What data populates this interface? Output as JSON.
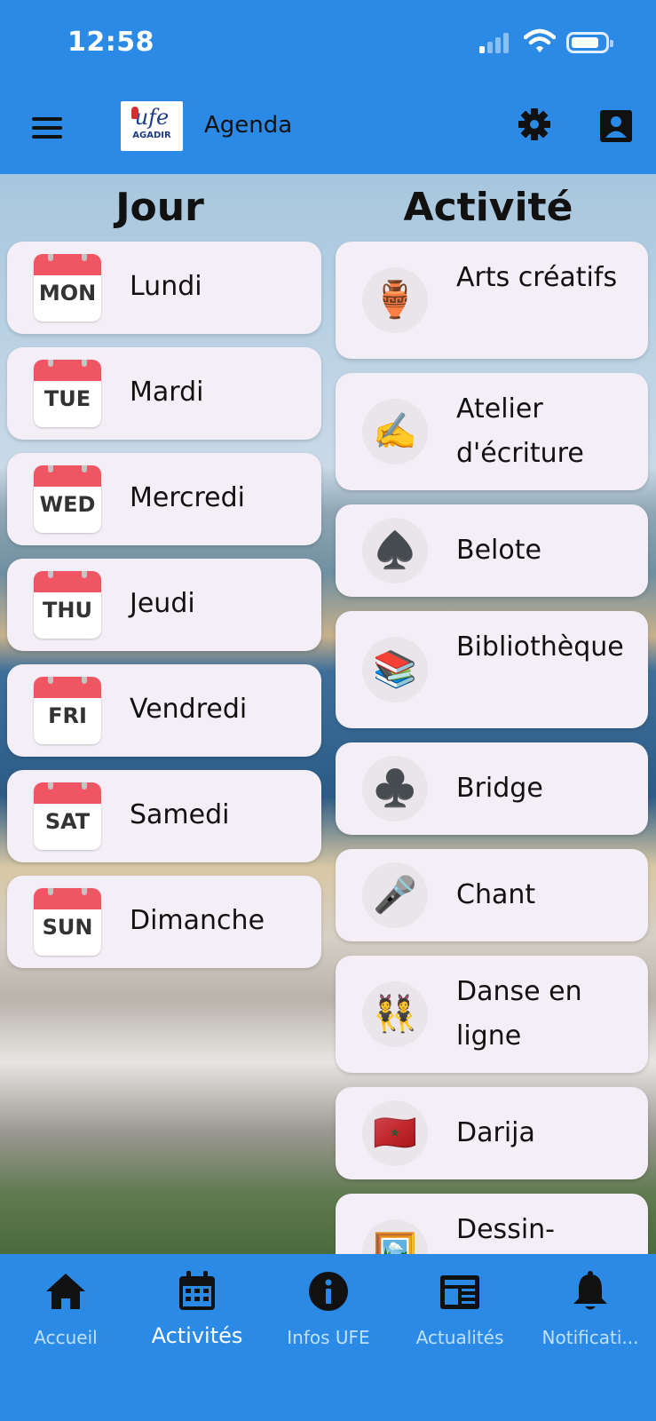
{
  "status_bar": {
    "time": "12:58"
  },
  "app_bar": {
    "logo": {
      "main": "ufe",
      "sub": "AGADIR"
    },
    "title": "Agenda"
  },
  "columns": {
    "day_header": "Jour",
    "activity_header": "Activité"
  },
  "days": [
    {
      "abbr": "MON",
      "name": "Lundi"
    },
    {
      "abbr": "TUE",
      "name": "Mardi"
    },
    {
      "abbr": "WED",
      "name": "Mercredi"
    },
    {
      "abbr": "THU",
      "name": "Jeudi"
    },
    {
      "abbr": "FRI",
      "name": "Vendredi"
    },
    {
      "abbr": "SAT",
      "name": "Samedi"
    },
    {
      "abbr": "SUN",
      "name": "Dimanche"
    }
  ],
  "activities": [
    {
      "name": "Arts créatifs",
      "icon": "amphora-icon",
      "emoji": "🏺"
    },
    {
      "name": "Atelier d'écriture",
      "icon": "writing-hand-icon",
      "emoji": "✍️"
    },
    {
      "name": "Belote",
      "icon": "spade-icon",
      "emoji": "♠️"
    },
    {
      "name": "Bibliothèque",
      "icon": "books-icon",
      "emoji": "📚"
    },
    {
      "name": "Bridge",
      "icon": "club-icon",
      "emoji": "♣️"
    },
    {
      "name": "Chant",
      "icon": "microphone-icon",
      "emoji": "🎤"
    },
    {
      "name": "Danse en ligne",
      "icon": "dancers-icon",
      "emoji": "👯"
    },
    {
      "name": "Darija",
      "icon": "morocco-flag-icon",
      "emoji": "🇲🇦"
    },
    {
      "name": "Dessin-",
      "icon": "framed-picture-icon",
      "emoji": "🖼️"
    }
  ],
  "bottom_nav": [
    {
      "label": "Accueil",
      "icon": "home-icon",
      "active": false
    },
    {
      "label": "Activités",
      "icon": "calendar-icon",
      "active": true
    },
    {
      "label": "Infos UFE",
      "icon": "info-icon",
      "active": false
    },
    {
      "label": "Actualités",
      "icon": "newspaper-icon",
      "active": false
    },
    {
      "label": "Notificati...",
      "icon": "bell-icon",
      "active": false
    }
  ],
  "colors": {
    "primary": "#2b8ae6",
    "card": "#f4eff6",
    "calendar_red": "#f05563",
    "nav_inactive": "#bfe0ff"
  }
}
